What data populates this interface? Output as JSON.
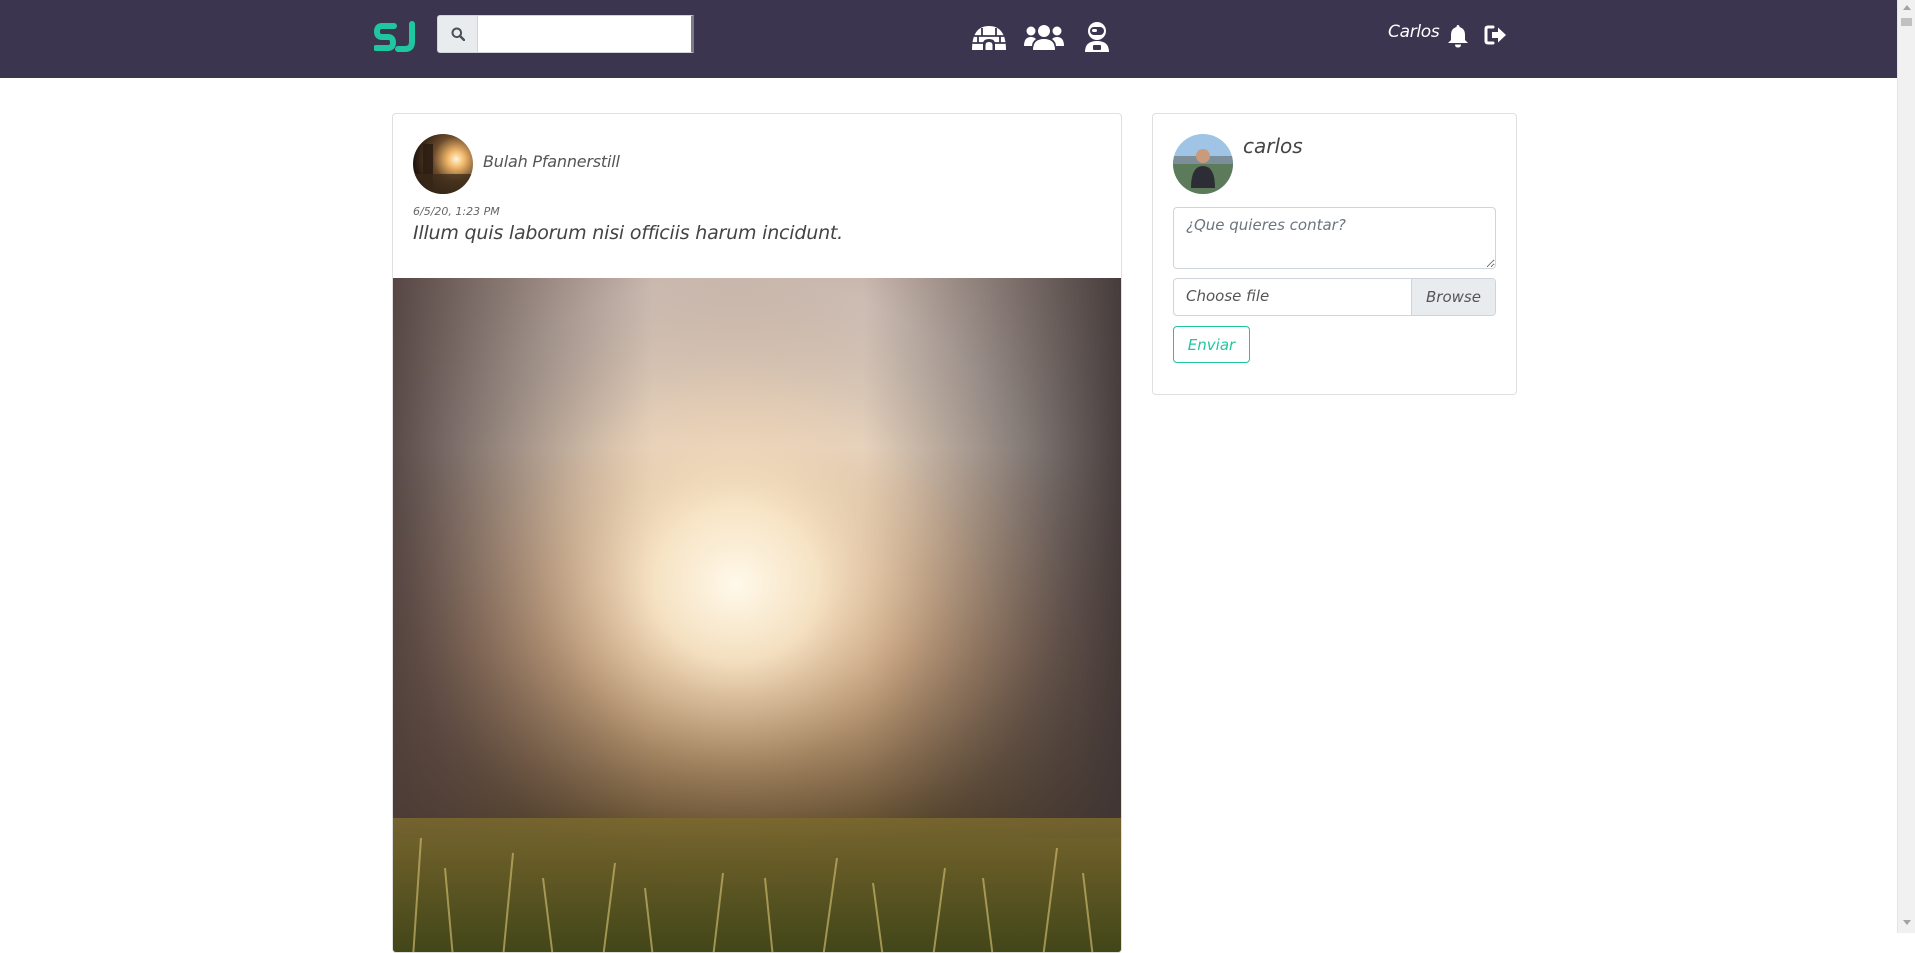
{
  "navbar": {
    "logo_text": "SJ",
    "search": {
      "value": "",
      "placeholder": ""
    },
    "icons": [
      "igloo-icon",
      "users-icon",
      "user-astronaut-icon"
    ],
    "user_name": "Carlos",
    "colors": {
      "background": "#3b3550",
      "brand": "#1ec7a0"
    }
  },
  "post": {
    "author": "Bulah Pfannerstill",
    "date": "6/5/20, 1:23 PM",
    "text": "Illum quis laborum nisi officiis harum incidunt."
  },
  "composer": {
    "user_name": "carlos",
    "textarea_placeholder": "¿Que quieres contar?",
    "file_label": "Choose file",
    "browse_label": "Browse",
    "submit_label": "Enviar"
  }
}
